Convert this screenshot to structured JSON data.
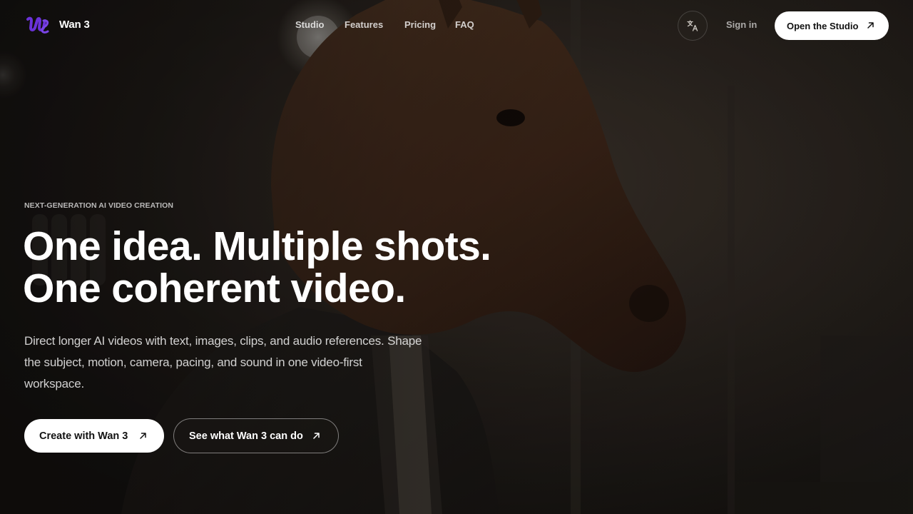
{
  "brand": {
    "name": "Wan 3",
    "logo_color": "#6a32d8"
  },
  "nav": {
    "items": [
      {
        "label": "Studio"
      },
      {
        "label": "Features"
      },
      {
        "label": "Pricing"
      },
      {
        "label": "FAQ"
      }
    ]
  },
  "header_actions": {
    "language_icon": "translate-icon",
    "sign_in_label": "Sign in",
    "open_studio_label": "Open the Studio"
  },
  "hero": {
    "eyebrow": "NEXT-GENERATION AI VIDEO CREATION",
    "headline_line1": "One idea. Multiple shots.",
    "headline_line2": "One coherent video.",
    "subcopy": "Direct longer AI videos with text, images, clips, and audio references. Shape the subject, motion, camera, pacing, and sound in one video-first workspace.",
    "primary_cta": "Create with Wan 3",
    "secondary_cta": "See what Wan 3 can do"
  },
  "icons": {
    "cta_arrow": "arrow-up-right-icon"
  },
  "colors": {
    "primary_button_bg": "#ffffff",
    "primary_button_text": "#121212",
    "background": "#1a1714"
  }
}
